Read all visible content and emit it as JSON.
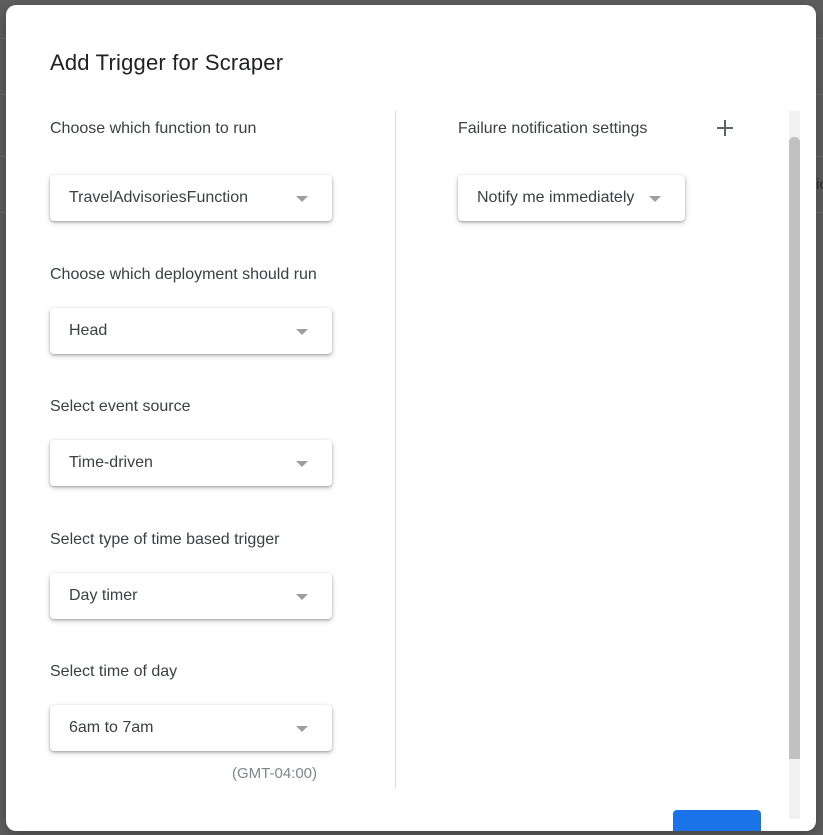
{
  "dialog": {
    "title": "Add Trigger for Scraper"
  },
  "left_column": {
    "fields": [
      {
        "label": "Choose which function to run",
        "value": "TravelAdvisoriesFunction"
      },
      {
        "label": "Choose which deployment should run",
        "value": "Head"
      },
      {
        "label": "Select event source",
        "value": "Time-driven"
      },
      {
        "label": "Select type of time based trigger",
        "value": "Day timer"
      },
      {
        "label": "Select time of day",
        "value": "6am to 7am"
      }
    ],
    "timezone": "(GMT-04:00)"
  },
  "right_column": {
    "label": "Failure notification settings",
    "add_icon": "plus-icon",
    "value": "Notify me immediately"
  },
  "background": {
    "partial_text": "ic"
  },
  "colors": {
    "primary": "#1a73e8",
    "text": "#3c4043",
    "overlay": "#5f5f5f"
  }
}
